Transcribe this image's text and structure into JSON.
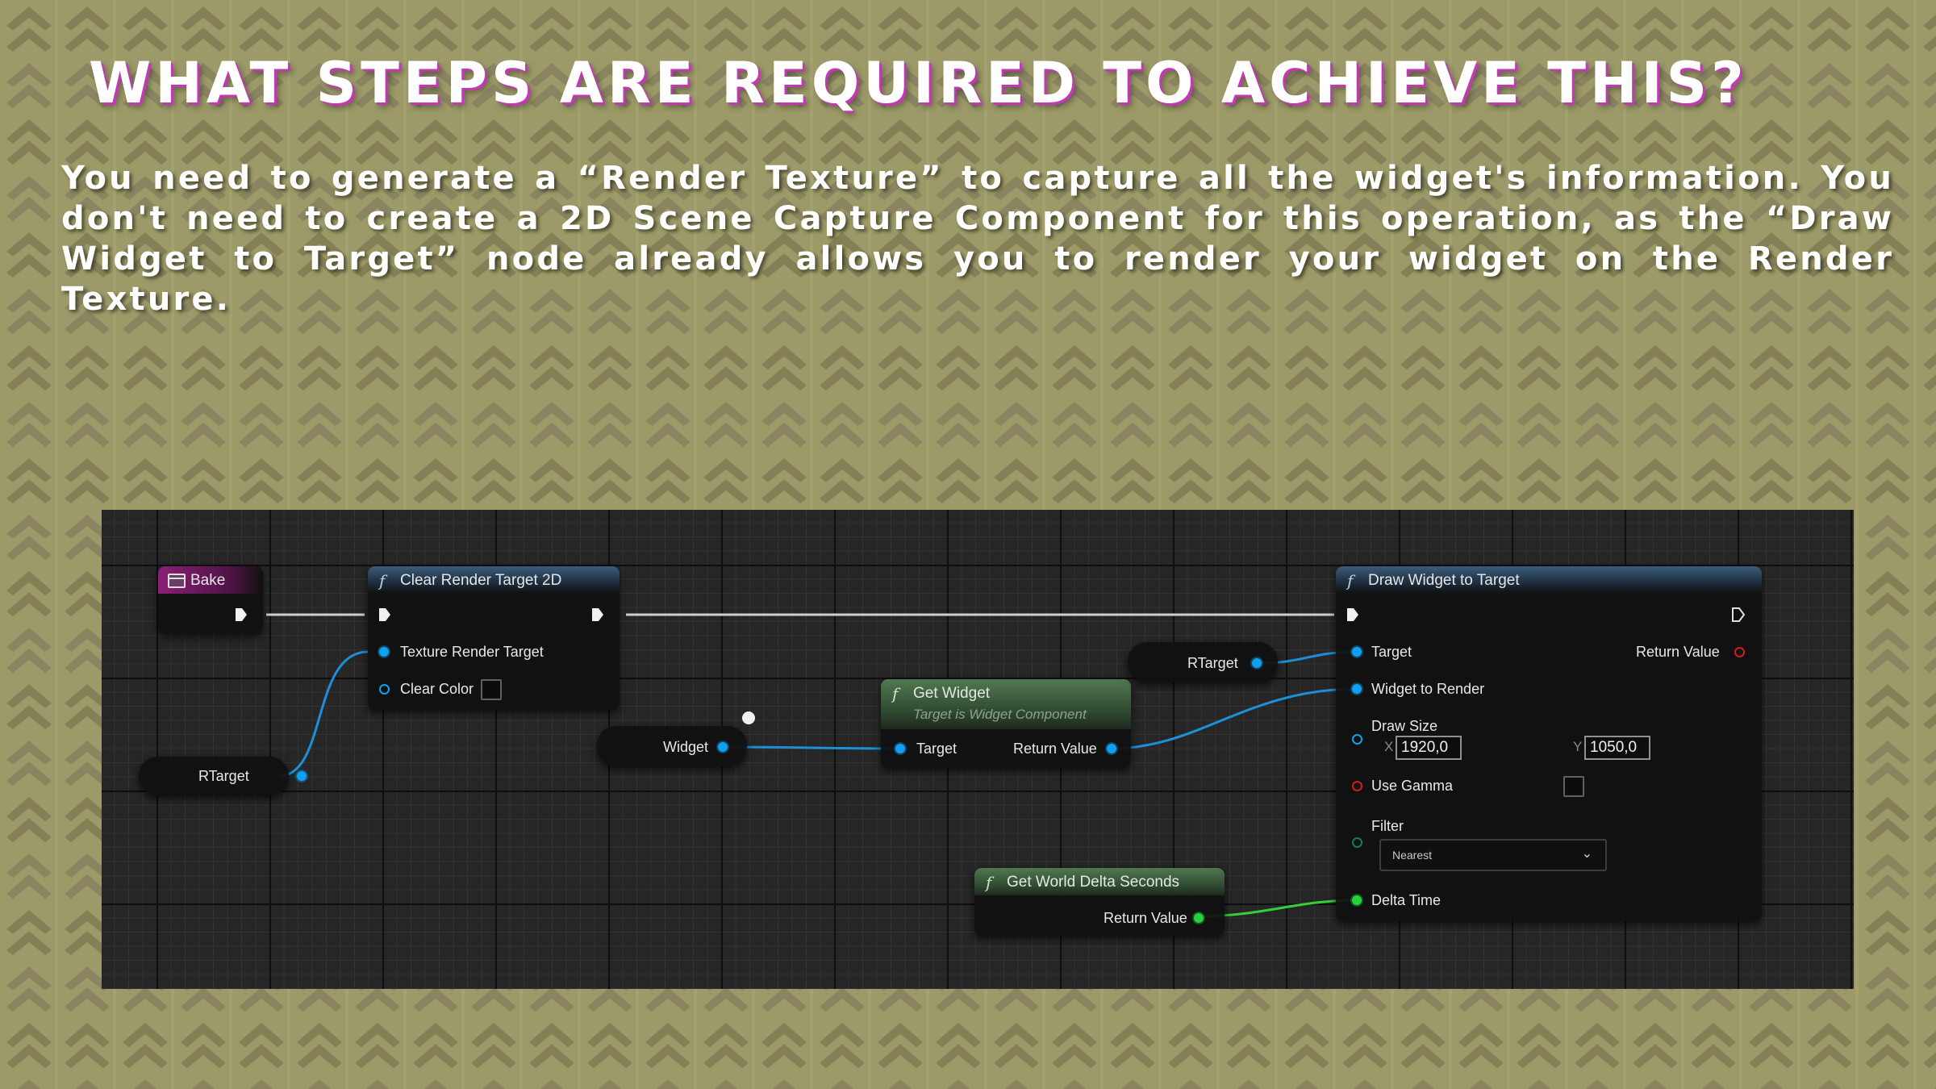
{
  "slide": {
    "title": "WHAT STEPS ARE REQUIRED TO ACHIEVE THIS?",
    "body": "You need to generate a “Render Texture” to capture all the widget's information. You don't need to create a 2D Scene Capture Component for this operation, as the “Draw Widget to Target” node already allows you to render your widget on the Render Texture."
  },
  "colors": {
    "background": "#9c9a68",
    "title_shadow": "#c23ab3",
    "exec_wire": "#cfcfcf",
    "object_wire": "#1d8fd8",
    "float_wire": "#34d03a"
  },
  "nodes": {
    "bake": {
      "title": "Bake"
    },
    "clear_rt": {
      "title": "Clear Render Target 2D",
      "pin_texture": "Texture Render Target",
      "pin_clear_color": "Clear Color"
    },
    "rtarget_left": {
      "label": "RTarget"
    },
    "widget_var": {
      "label": "Widget"
    },
    "get_widget": {
      "title": "Get Widget",
      "subtitle": "Target is Widget Component",
      "pin_target": "Target",
      "pin_return": "Return Value"
    },
    "rtarget_right": {
      "label": "RTarget"
    },
    "draw_widget": {
      "title": "Draw Widget to Target",
      "pin_target": "Target",
      "pin_return": "Return Value",
      "pin_widget": "Widget to Render",
      "draw_size_label": "Draw Size",
      "x_label": "X",
      "x_value": "1920,0",
      "y_label": "Y",
      "y_value": "1050,0",
      "use_gamma": "Use Gamma",
      "filter_label": "Filter",
      "filter_value": "Nearest",
      "delta_time": "Delta Time"
    },
    "get_delta": {
      "title": "Get World Delta Seconds",
      "pin_return": "Return Value"
    }
  }
}
